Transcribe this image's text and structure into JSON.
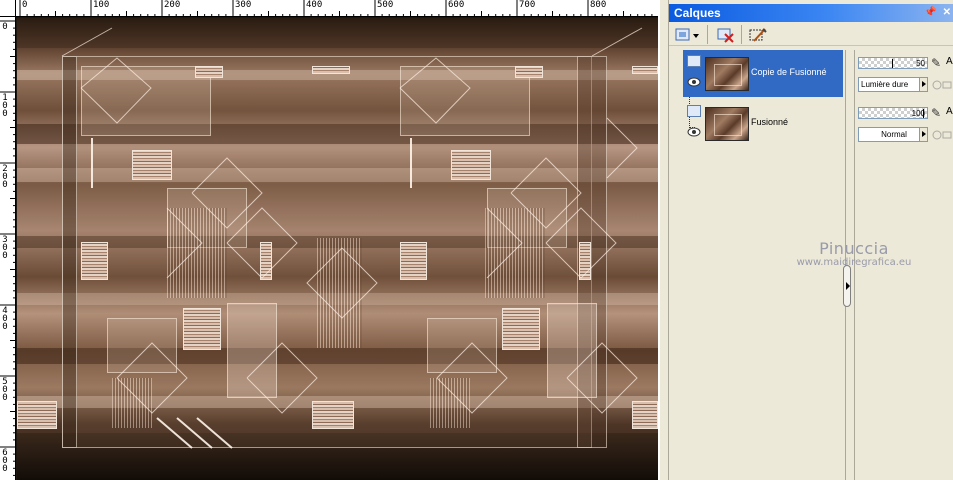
{
  "rulers": {
    "h_labels": [
      "0",
      "100",
      "200",
      "300",
      "400",
      "500",
      "600",
      "700",
      "800"
    ],
    "v_labels": [
      "0",
      "100",
      "200",
      "300",
      "400",
      "500",
      "600"
    ]
  },
  "palette": {
    "title": "Calques",
    "layers": [
      {
        "name": "Copie de Fusionné",
        "selected": true
      },
      {
        "name": "Fusionné",
        "selected": false
      }
    ],
    "props": [
      {
        "opacity": "50",
        "blend": "Lumière dure",
        "letter": "A"
      },
      {
        "opacity": "100",
        "blend": "Normal",
        "letter": "A"
      }
    ]
  },
  "watermark": {
    "signature": "Pinuccia",
    "url": "www.maidiregrafica.eu"
  },
  "icons": {
    "new_layer": "new-layer-icon",
    "delete_layer": "delete-layer-icon",
    "edit_selection": "edit-selection-icon",
    "visibility": "eye-icon",
    "pin": "pin-icon",
    "close": "close-icon"
  }
}
